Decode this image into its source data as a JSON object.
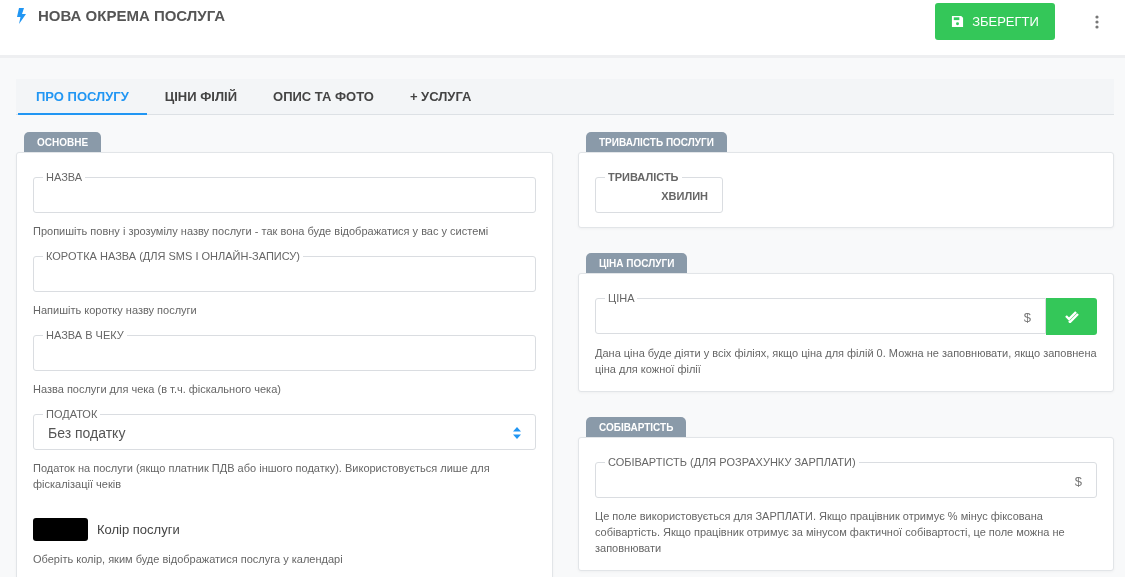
{
  "header": {
    "title": "НОВА ОКРЕМА ПОСЛУГА",
    "save_label": "ЗБЕРЕГТИ"
  },
  "tabs": [
    {
      "label": "ПРО ПОСЛУГУ",
      "selected": true
    },
    {
      "label": "ЦІНИ ФІЛІЙ",
      "selected": false
    },
    {
      "label": "ОПИС ТА ФОТО",
      "selected": false
    },
    {
      "label": "+ УСЛУГА",
      "selected": false
    }
  ],
  "columns": [
    [
      {
        "title": "ОСНОВНЕ",
        "fields": [
          {
            "kind": "text",
            "label": "НАЗВА",
            "hint": "Пропишіть повну і зрозумілу назву послуги - так вона буде відображатися у вас у системі"
          },
          {
            "kind": "text",
            "label": "КОРОТКА НАЗВА (ДЛЯ SMS І ОНЛАЙН-ЗАПИСУ)",
            "hint": "Напишіть коротку назву послуги"
          },
          {
            "kind": "text",
            "label": "НАЗВА В ЧЕКУ",
            "hint": "Назва послуги для чека (в т.ч. фіскального чека)"
          },
          {
            "kind": "select",
            "label": "ПОДАТОК",
            "value": "Без податку",
            "hint": "Податок на послуги (якщо платник ПДВ або іншого податку). Використовується лише для фіскалізації чеків"
          },
          {
            "kind": "color",
            "label": "Колір послуги",
            "color": "#000000",
            "hint": "Оберіть колір, яким буде відображатися послуга у календарі"
          }
        ]
      }
    ],
    [
      {
        "title": "ТРИВАЛІСТЬ ПОСЛУГИ",
        "fields": [
          {
            "kind": "duration",
            "label": "ТРИВАЛІСТЬ",
            "unit": "ХВИЛИН"
          }
        ]
      },
      {
        "title": "ЦІНА ПОСЛУГИ",
        "fields": [
          {
            "kind": "price",
            "label": "ЦІНА",
            "suffix": "$",
            "confirm": true,
            "hint": "Дана ціна буде діяти у всіх філіях, якщо ціна для філій 0. Можна не заповнювати, якщо заповнена ціна для кожної філії"
          }
        ]
      },
      {
        "title": "СОБІВАРТІСТЬ",
        "fields": [
          {
            "kind": "price",
            "label": "СОБІВАРТІСТЬ (ДЛЯ РОЗРАХУНКУ ЗАРПЛАТИ)",
            "suffix": "$",
            "confirm": false,
            "hint": "Це поле використовується для ЗАРПЛАТИ. Якщо працівник отримує % мінус фіксована собівартість. Якщо працівник отримує за мінусом фактичної собівартості, це поле можна не заповнювати"
          }
        ]
      }
    ]
  ]
}
